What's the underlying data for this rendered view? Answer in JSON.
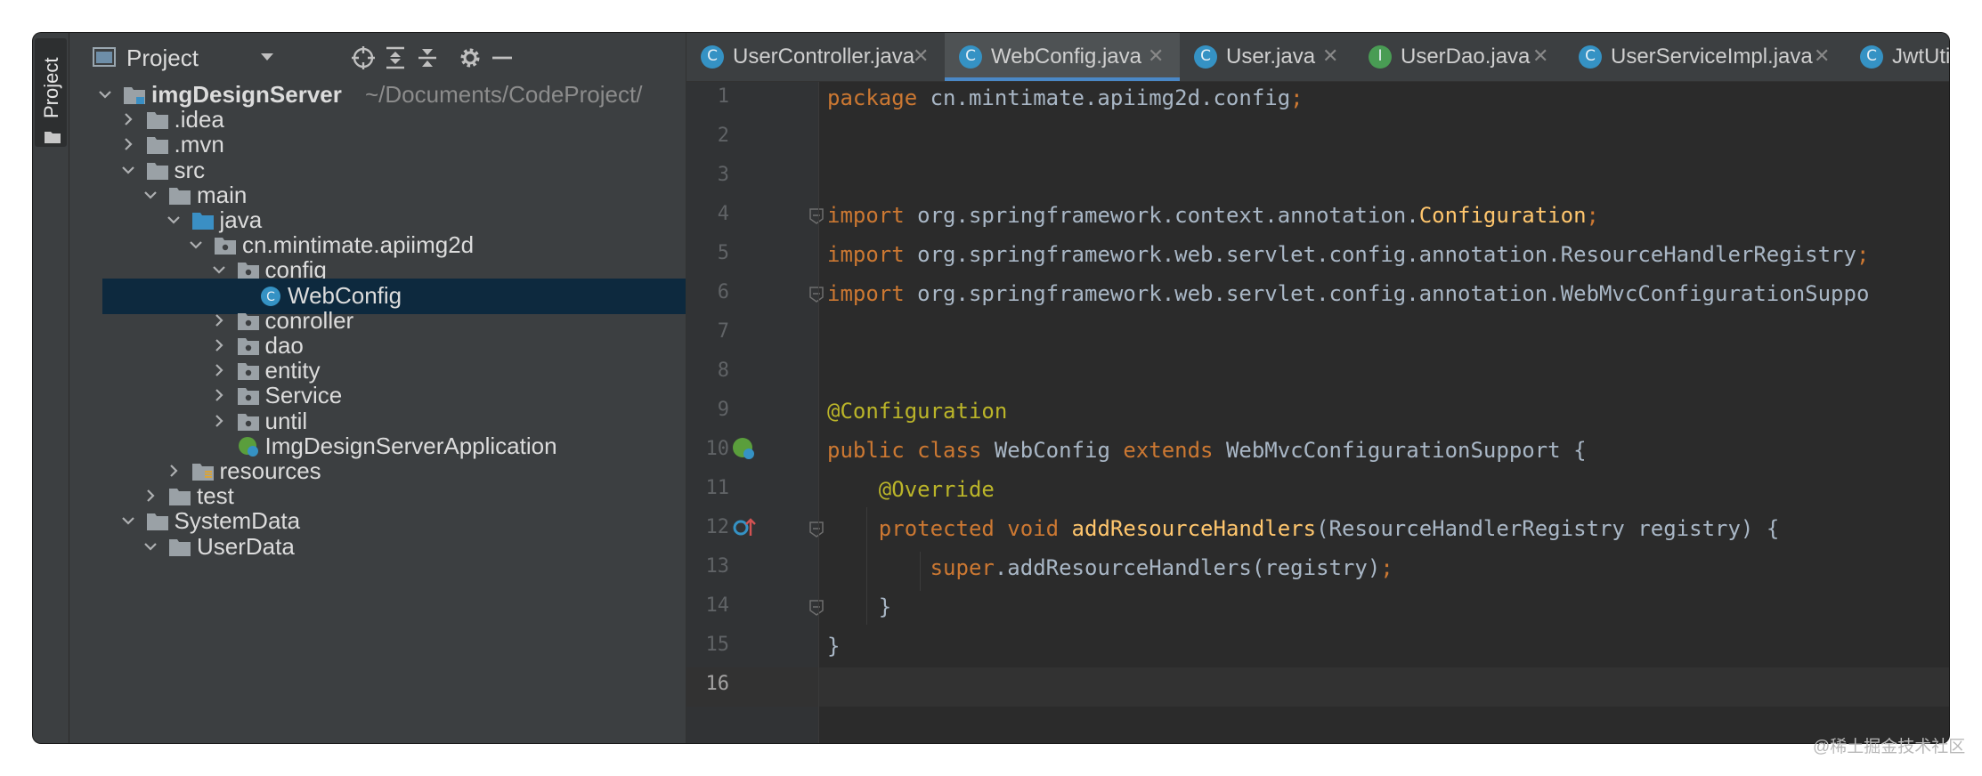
{
  "toolstrip": {
    "label": "Project"
  },
  "panel": {
    "title": "Project",
    "tree": [
      {
        "label": "imgDesignServer",
        "path": "~/Documents/CodeProject/",
        "depth": 0,
        "arrow": "down",
        "icon": "module-folder"
      },
      {
        "label": ".idea",
        "depth": 1,
        "arrow": "right",
        "icon": "folder"
      },
      {
        "label": ".mvn",
        "depth": 1,
        "arrow": "right",
        "icon": "folder"
      },
      {
        "label": "src",
        "depth": 1,
        "arrow": "down",
        "icon": "folder"
      },
      {
        "label": "main",
        "depth": 2,
        "arrow": "down",
        "icon": "folder"
      },
      {
        "label": "java",
        "depth": 3,
        "arrow": "down",
        "icon": "source-folder"
      },
      {
        "label": "cn.mintimate.apiimg2d",
        "depth": 4,
        "arrow": "down",
        "icon": "package"
      },
      {
        "label": "config",
        "depth": 5,
        "arrow": "down",
        "icon": "package"
      },
      {
        "label": "WebConfig",
        "depth": 6,
        "arrow": "none",
        "icon": "class",
        "selected": true
      },
      {
        "label": "conroller",
        "depth": 5,
        "arrow": "right",
        "icon": "package"
      },
      {
        "label": "dao",
        "depth": 5,
        "arrow": "right",
        "icon": "package"
      },
      {
        "label": "entity",
        "depth": 5,
        "arrow": "right",
        "icon": "package"
      },
      {
        "label": "Service",
        "depth": 5,
        "arrow": "right",
        "icon": "package"
      },
      {
        "label": "until",
        "depth": 5,
        "arrow": "right",
        "icon": "package"
      },
      {
        "label": "ImgDesignServerApplication",
        "depth": 5,
        "arrow": "none",
        "icon": "spring-app"
      },
      {
        "label": "resources",
        "depth": 3,
        "arrow": "right",
        "icon": "resources-folder"
      },
      {
        "label": "test",
        "depth": 2,
        "arrow": "right",
        "icon": "folder"
      },
      {
        "label": "SystemData",
        "depth": 1,
        "arrow": "down",
        "icon": "folder"
      },
      {
        "label": "UserData",
        "depth": 2,
        "arrow": "down",
        "icon": "folder"
      }
    ]
  },
  "tabs": [
    {
      "label": "UserController.java",
      "icon": "class-icon",
      "letter": "C",
      "color": "#3592c4",
      "active": false,
      "closable": true
    },
    {
      "label": "WebConfig.java",
      "icon": "class-icon",
      "letter": "C",
      "color": "#3592c4",
      "active": true,
      "closable": true
    },
    {
      "label": "User.java",
      "icon": "class-icon",
      "letter": "C",
      "color": "#3592c4",
      "active": false,
      "closable": true
    },
    {
      "label": "UserDao.java",
      "icon": "interface-icon",
      "letter": "I",
      "color": "#499c54",
      "active": false,
      "closable": true
    },
    {
      "label": "UserServiceImpl.java",
      "icon": "class-icon",
      "letter": "C",
      "color": "#3592c4",
      "active": false,
      "closable": true
    },
    {
      "label": "JwtUti",
      "icon": "class-icon",
      "letter": "C",
      "color": "#3592c4",
      "active": false,
      "closable": false
    }
  ],
  "editor": {
    "current_line": 16,
    "lines": [
      [
        {
          "t": "package ",
          "c": "kw"
        },
        {
          "t": "cn.mintimate.apiimg2d.config"
        },
        {
          "t": ";",
          "c": "kw"
        }
      ],
      [],
      [],
      [
        {
          "t": "import ",
          "c": "kw"
        },
        {
          "t": "org.springframework.context.annotation."
        },
        {
          "t": "Configuration",
          "c": "cls"
        },
        {
          "t": ";",
          "c": "kw"
        }
      ],
      [
        {
          "t": "import ",
          "c": "kw"
        },
        {
          "t": "org.springframework.web.servlet.config.annotation.ResourceHandlerRegistry"
        },
        {
          "t": ";",
          "c": "kw"
        }
      ],
      [
        {
          "t": "import ",
          "c": "kw"
        },
        {
          "t": "org.springframework.web.servlet.config.annotation.WebMvcConfigurationSuppo"
        }
      ],
      [],
      [],
      [
        {
          "t": "@Configuration",
          "c": "ann"
        }
      ],
      [
        {
          "t": "public class ",
          "c": "kw"
        },
        {
          "t": "WebConfig "
        },
        {
          "t": "extends ",
          "c": "kw"
        },
        {
          "t": "WebMvcConfigurationSupport {"
        }
      ],
      [
        {
          "t": "    "
        },
        {
          "t": "@Override",
          "c": "ann"
        }
      ],
      [
        {
          "t": "    "
        },
        {
          "t": "protected void ",
          "c": "kw"
        },
        {
          "t": "addResourceHandlers",
          "c": "fn"
        },
        {
          "t": "(ResourceHandlerRegistry registry) {"
        }
      ],
      [
        {
          "t": "        "
        },
        {
          "t": "super",
          "c": "kw"
        },
        {
          "t": ".addResourceHandlers(registry)"
        },
        {
          "t": ";",
          "c": "kw"
        }
      ],
      [
        {
          "t": "    }"
        }
      ],
      [
        {
          "t": "}"
        }
      ],
      []
    ]
  },
  "watermark": "@稀土掘金技术社区",
  "colors": {
    "bg": "#2b2b2b",
    "panel": "#3c3f41",
    "selection": "#0d293e",
    "keyword": "#cc7832",
    "annotation": "#bbb529",
    "method": "#ffc66d"
  }
}
